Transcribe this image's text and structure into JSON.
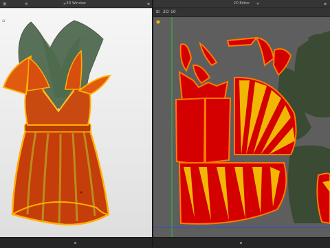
{
  "panels": {
    "left": {
      "title": "3D Window"
    },
    "right": {
      "title": "2D Editor"
    }
  },
  "toolbar_2d": {
    "items": [
      {
        "label": "⊞",
        "icon": "grid-icon"
      },
      {
        "label": "2D",
        "icon": "2d-mode-icon"
      },
      {
        "label": "10",
        "icon": "zoom-level-icon"
      }
    ]
  },
  "icons": [
    "window-icon",
    "dropdown-chevron-icon",
    "tool-status-icon"
  ],
  "colors": {
    "accent_red": "#d40000",
    "accent_yellow": "#f2b705",
    "outline_orange": "#ff7a00",
    "dark_green_pattern": "#3a4a33",
    "viewport_2d_bg": "#5e5e5e",
    "viewport_3d_bg": "#eeeeee",
    "guide_green": "#2fbf3f",
    "guide_blue": "#2b4fd8"
  }
}
